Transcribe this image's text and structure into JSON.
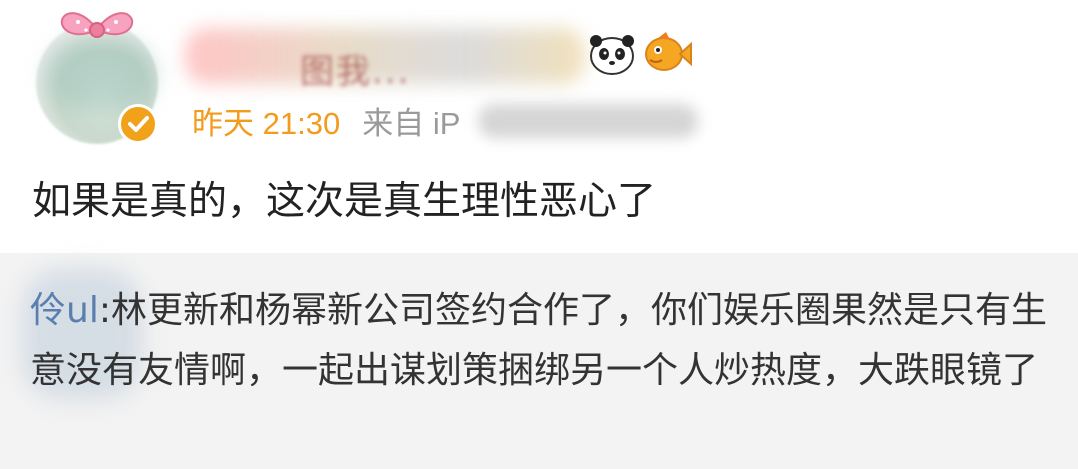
{
  "post": {
    "time": "昨天 21:30",
    "source_label": "来自 iP",
    "content": "如果是真的，这次是真生理性恶心了"
  },
  "repost": {
    "username_visible": "伶ul",
    "text": ":林更新和杨幂新公司签约合作了，你们娱乐圈果然是只有生意没有友情啊，一起出谋划策捆绑另一个人炒热度，大跌眼镜了"
  },
  "icons": {
    "verified": "verified-badge-icon",
    "bow": "pink-bow-icon",
    "panda": "panda-emoji-icon",
    "fish": "fish-emoji-icon"
  },
  "colors": {
    "time": "#f29b1c",
    "source": "#9a9a9a",
    "repost_user": "#5a7fae",
    "repost_bg": "#f3f3f3"
  }
}
